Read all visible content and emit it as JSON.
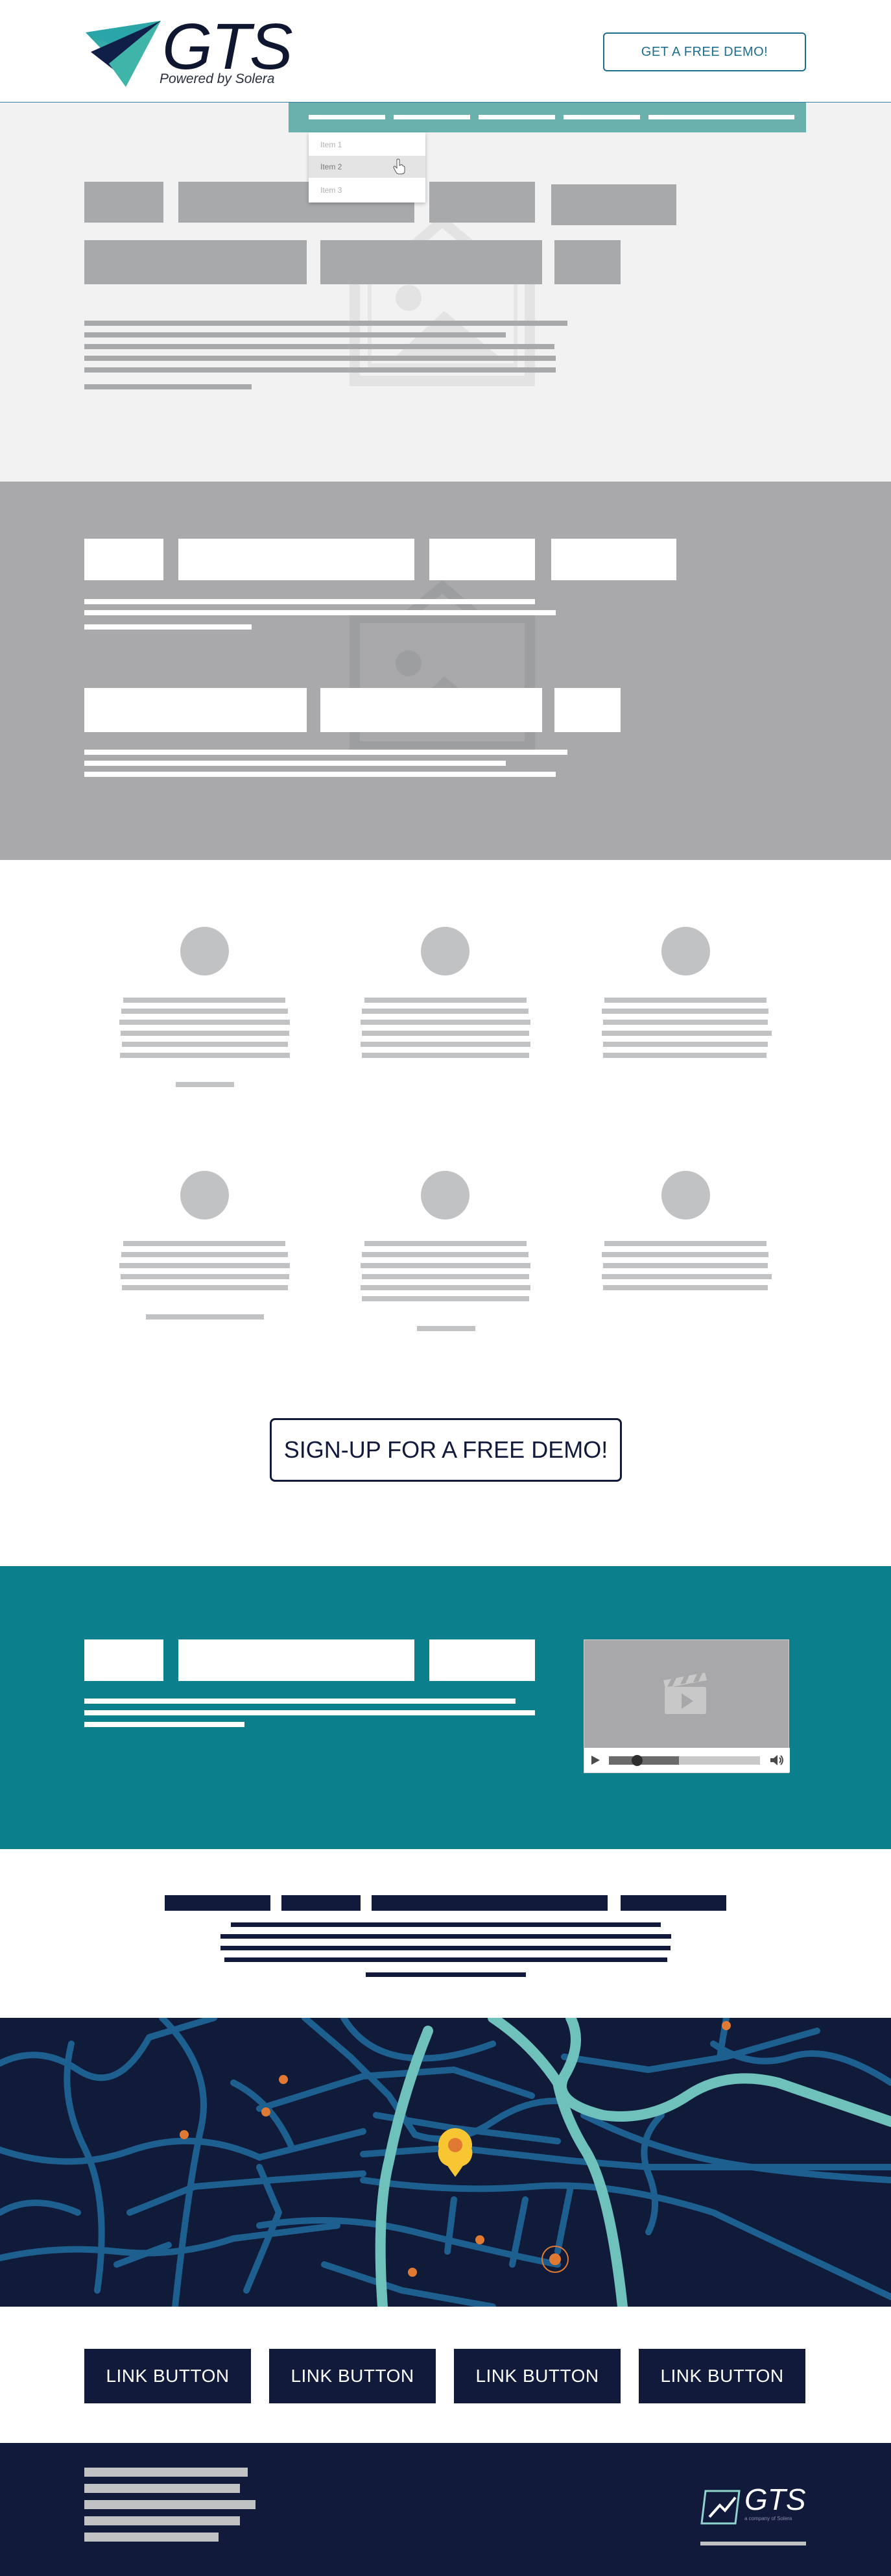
{
  "header": {
    "logo_text": "GTS",
    "logo_subtitle": "Powered by Solera",
    "demo_button_label": "GET A FREE DEMO!"
  },
  "nav": {
    "dropdown_items": [
      "Item 1",
      "Item 2",
      "Item 3"
    ],
    "selected_index": 1
  },
  "features": {
    "signup_button_label": "SIGN-UP FOR A FREE DEMO!"
  },
  "link_buttons": [
    "LINK BUTTON",
    "LINK BUTTON",
    "LINK BUTTON",
    "LINK BUTTON"
  ],
  "footer": {
    "logo_text": "GTS",
    "logo_subtitle": "a company of Solera"
  },
  "colors": {
    "navy": "#111a3b",
    "teal_nav": "#6ab1ae",
    "teal_section": "#0c7f8c",
    "placeholder_gray": "#a8a9ab",
    "map_road": "#1d5f8f",
    "map_highlight": "#6fc1bb",
    "map_pin": "#f8c632",
    "map_dot": "#e07a32"
  },
  "icons": [
    "image-placeholder-icon",
    "cursor-hand-icon",
    "clapperboard-icon",
    "play-icon",
    "volume-icon",
    "map-pin-icon"
  ]
}
